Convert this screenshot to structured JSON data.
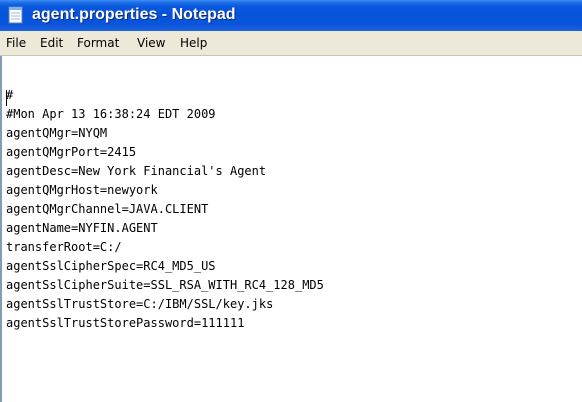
{
  "window": {
    "title": "agent.properties - Notepad",
    "app_icon": "notepad-icon"
  },
  "menu": {
    "items": [
      "File",
      "Edit",
      "Format",
      "View",
      "Help"
    ]
  },
  "editor": {
    "lines": [
      "#",
      "#Mon Apr 13 16:38:24 EDT 2009",
      "agentQMgr=NYQM",
      "agentQMgrPort=2415",
      "agentDesc=New York Financial's Agent",
      "agentQMgrHost=newyork",
      "agentQMgrChannel=JAVA.CLIENT",
      "agentName=NYFIN.AGENT",
      "transferRoot=C:/",
      "agentSslCipherSpec=RC4_MD5_US",
      "agentSslCipherSuite=SSL_RSA_WITH_RC4_128_MD5",
      "agentSslTrustStore=C:/IBM/SSL/key.jks",
      "agentSslTrustStorePassword=111111"
    ]
  }
}
